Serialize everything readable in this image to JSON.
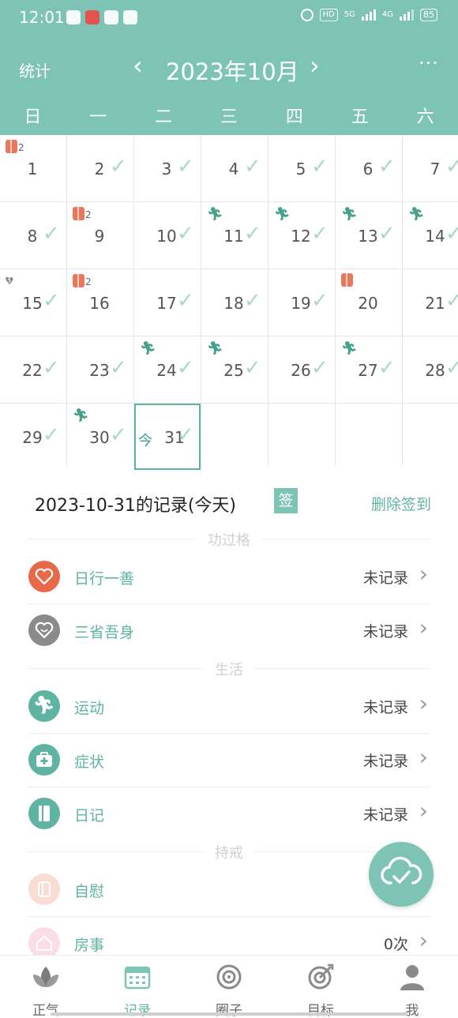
{
  "status_bar": {
    "time": "12:01",
    "hd": "HD",
    "net1": "5G",
    "net2": "4G",
    "battery": "85"
  },
  "nav": {
    "stats_label": "统计",
    "prev": "‹",
    "title": "2023年10月",
    "next": "›",
    "more": "···"
  },
  "weekdays": [
    "日",
    "一",
    "二",
    "三",
    "四",
    "五",
    "六"
  ],
  "calendar": {
    "days": [
      {
        "n": "1",
        "check": false,
        "icon": "roll",
        "sup": "2"
      },
      {
        "n": "2",
        "check": true
      },
      {
        "n": "3",
        "check": true
      },
      {
        "n": "4",
        "check": true
      },
      {
        "n": "5",
        "check": true
      },
      {
        "n": "6",
        "check": true
      },
      {
        "n": "7",
        "check": true
      },
      {
        "n": "8",
        "check": true
      },
      {
        "n": "9",
        "check": false,
        "icon": "roll",
        "sup": "2"
      },
      {
        "n": "10",
        "check": true
      },
      {
        "n": "11",
        "check": true,
        "icon": "run"
      },
      {
        "n": "12",
        "check": true,
        "icon": "run"
      },
      {
        "n": "13",
        "check": true,
        "icon": "run"
      },
      {
        "n": "14",
        "check": true,
        "icon": "run"
      },
      {
        "n": "15",
        "check": true,
        "icon": "heart"
      },
      {
        "n": "16",
        "check": false,
        "icon": "roll",
        "sup": "2"
      },
      {
        "n": "17",
        "check": true
      },
      {
        "n": "18",
        "check": true
      },
      {
        "n": "19",
        "check": true
      },
      {
        "n": "20",
        "check": false,
        "icon": "roll"
      },
      {
        "n": "21",
        "check": true
      },
      {
        "n": "22",
        "check": true
      },
      {
        "n": "23",
        "check": true
      },
      {
        "n": "24",
        "check": true,
        "icon": "run"
      },
      {
        "n": "25",
        "check": true,
        "icon": "run"
      },
      {
        "n": "26",
        "check": true
      },
      {
        "n": "27",
        "check": true,
        "icon": "run"
      },
      {
        "n": "28",
        "check": true
      },
      {
        "n": "29",
        "check": true
      },
      {
        "n": "30",
        "check": true,
        "icon": "run"
      },
      {
        "n": "31",
        "check": true,
        "today": true,
        "today_label": "今"
      },
      {
        "n": ""
      },
      {
        "n": ""
      },
      {
        "n": ""
      },
      {
        "n": ""
      }
    ]
  },
  "record": {
    "title": "2023-10-31的记录(今天)",
    "badge": "签",
    "delete_label": "删除签到"
  },
  "sections": {
    "merit": "功过格",
    "life": "生活",
    "abstain": "持戒"
  },
  "rows": {
    "good_deed": {
      "label": "日行一善",
      "value": "未记录",
      "icon": "heart-icon",
      "color": "#e8684a"
    },
    "reflect": {
      "label": "三省吾身",
      "value": "未记录",
      "icon": "heart-outline-icon",
      "color": "#8a8a8a"
    },
    "sport": {
      "label": "运动",
      "value": "未记录",
      "icon": "running-icon",
      "color": "#5fb3a2"
    },
    "symptom": {
      "label": "症状",
      "value": "未记录",
      "icon": "medkit-icon",
      "color": "#5fb3a2"
    },
    "diary": {
      "label": "日记",
      "value": "未记录",
      "icon": "book-icon",
      "color": "#5fb3a2"
    },
    "self": {
      "label": "自慰",
      "value": "",
      "icon": "roll-icon",
      "color": "#fbdcd3"
    },
    "house": {
      "label": "房事",
      "value": "0次",
      "icon": "house-icon",
      "color": "#fbdde6"
    }
  },
  "tabs": [
    {
      "label": "正气",
      "icon": "lotus-icon",
      "active": false
    },
    {
      "label": "记录",
      "icon": "calendar-icon",
      "active": true
    },
    {
      "label": "圈子",
      "icon": "circle-icon",
      "active": false
    },
    {
      "label": "目标",
      "icon": "target-icon",
      "active": false
    },
    {
      "label": "我",
      "icon": "person-icon",
      "active": false
    }
  ],
  "colors": {
    "primary": "#7ec4b5",
    "accent": "#5fb3a2",
    "check": "#a8d8cd"
  }
}
